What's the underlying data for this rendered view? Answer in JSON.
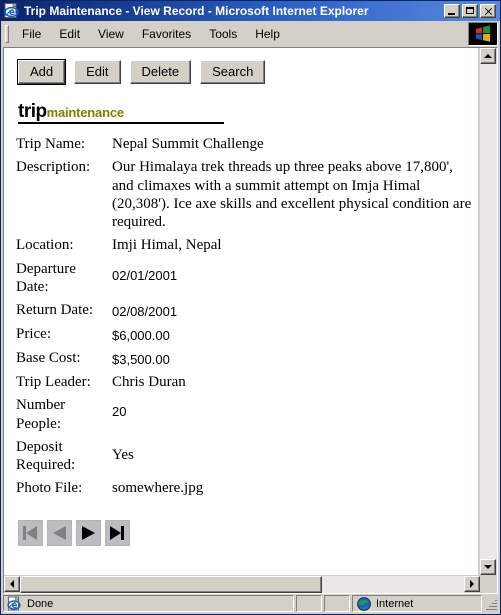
{
  "window": {
    "title": "Trip Maintenance - View Record - Microsoft Internet Explorer",
    "icon": "ie-document-icon",
    "controls": {
      "minimize": "Minimize",
      "maximize": "Maximize",
      "close": "Close"
    }
  },
  "menubar": {
    "items": [
      {
        "label": "File"
      },
      {
        "label": "Edit"
      },
      {
        "label": "View"
      },
      {
        "label": "Favorites"
      },
      {
        "label": "Tools"
      },
      {
        "label": "Help"
      }
    ],
    "brand_logo": "windows-flag-logo"
  },
  "toolbar": {
    "buttons": [
      {
        "label": "Add",
        "default": true
      },
      {
        "label": "Edit",
        "default": false
      },
      {
        "label": "Delete",
        "default": false
      },
      {
        "label": "Search",
        "default": false
      }
    ]
  },
  "heading": {
    "primary": "trip",
    "secondary": "maintenance",
    "primary_color": "#000000",
    "secondary_color": "#808000"
  },
  "record": {
    "fields": [
      {
        "label": "Trip Name:",
        "value": "Nepal Summit Challenge",
        "style": "serif",
        "two_line_label": false
      },
      {
        "label": "Description:",
        "value": "Our Himalaya trek threads up three peaks above 17,800', and climaxes with a summit attempt on Imja Himal (20,308'). Ice axe skills and excellent physical condition are required.",
        "style": "serif",
        "two_line_label": false
      },
      {
        "label": "Location:",
        "value": "Imji Himal, Nepal",
        "style": "serif",
        "two_line_label": false
      },
      {
        "label": "Departure Date:",
        "value": "02/01/2001",
        "style": "numeric",
        "two_line_label": true
      },
      {
        "label": "Return Date:",
        "value": "02/08/2001",
        "style": "numeric",
        "two_line_label": false
      },
      {
        "label": "Price:",
        "value": "$6,000.00",
        "style": "numeric",
        "two_line_label": false
      },
      {
        "label": "Base Cost:",
        "value": "$3,500.00",
        "style": "numeric",
        "two_line_label": false
      },
      {
        "label": "Trip Leader:",
        "value": "Chris Duran",
        "style": "serif",
        "two_line_label": false
      },
      {
        "label": "Number People:",
        "value": "20",
        "style": "numeric",
        "two_line_label": true
      },
      {
        "label": "Deposit Required:",
        "value": "Yes",
        "style": "serif",
        "two_line_label": true
      },
      {
        "label": "Photo File:",
        "value": "somewhere.jpg",
        "style": "serif",
        "two_line_label": false
      }
    ]
  },
  "record_nav": {
    "buttons": [
      {
        "name": "first-record-button",
        "icon": "skip-to-first-icon",
        "state": "disabled"
      },
      {
        "name": "previous-record-button",
        "icon": "previous-icon",
        "state": "disabled"
      },
      {
        "name": "next-record-button",
        "icon": "next-icon",
        "state": "enabled"
      },
      {
        "name": "last-record-button",
        "icon": "skip-to-last-icon",
        "state": "enabled"
      }
    ]
  },
  "statusbar": {
    "message": "Done",
    "message_icon": "ie-document-icon",
    "zone": "Internet",
    "zone_icon": "globe-icon"
  }
}
